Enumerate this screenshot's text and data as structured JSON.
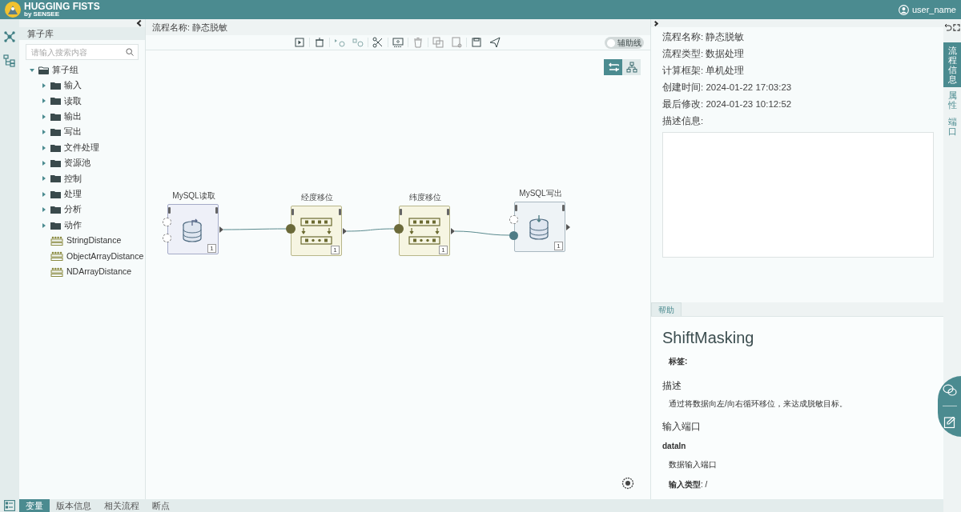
{
  "header": {
    "brand": "HUGGING FISTS",
    "brand_sub": "by SENSEE",
    "user": "user_name"
  },
  "library": {
    "title": "算子库",
    "search_placeholder": "请输入搜索内容",
    "tree": [
      {
        "label": "算子组",
        "kind": "folder",
        "expanded": true,
        "children": [
          {
            "label": "输入",
            "kind": "folder",
            "expanded": false
          },
          {
            "label": "读取",
            "kind": "folder",
            "expanded": false
          },
          {
            "label": "输出",
            "kind": "folder",
            "expanded": false
          },
          {
            "label": "写出",
            "kind": "folder",
            "expanded": false
          },
          {
            "label": "文件处理",
            "kind": "folder",
            "expanded": false
          },
          {
            "label": "资源池",
            "kind": "folder",
            "expanded": false
          },
          {
            "label": "控制",
            "kind": "folder",
            "expanded": false
          },
          {
            "label": "处理",
            "kind": "folder",
            "expanded": false
          },
          {
            "label": "分析",
            "kind": "folder",
            "expanded": false
          },
          {
            "label": "动作",
            "kind": "folder",
            "expanded": false
          },
          {
            "label": "StringDistance",
            "kind": "operator"
          },
          {
            "label": "ObjectArrayDistance",
            "kind": "operator"
          },
          {
            "label": "NDArrayDistance",
            "kind": "operator"
          }
        ]
      }
    ]
  },
  "flow_title": "流程名称: 静态脱敏",
  "toolbar": {
    "guide_toggle": {
      "label": "辅助线",
      "on": false
    },
    "view_buttons": [
      {
        "kind": "flow",
        "selected": true
      },
      {
        "kind": "tree",
        "selected": false
      }
    ]
  },
  "nodes": [
    {
      "label": "MySQL读取",
      "kind": "mysql_read",
      "count": "1"
    },
    {
      "label": "经度移位",
      "kind": "shift",
      "count": "1"
    },
    {
      "label": "纬度移位",
      "kind": "shift",
      "count": "1"
    },
    {
      "label": "MySQL写出",
      "kind": "mysql_write",
      "count": "1"
    }
  ],
  "info": {
    "lines": [
      "流程名称: 静态脱敏",
      "流程类型: 数据处理",
      "计算框架: 单机处理",
      "创建时间: 2024-01-22 17:03:23",
      "最后修改: 2024-01-23 10:12:52"
    ],
    "description_label": "描述信息:"
  },
  "help": {
    "tab": "帮助",
    "title": "ShiftMasking",
    "tag_label": "标签:",
    "description_heading": "描述",
    "description": "通过将数据向左/向右循环移位，来达成脱敏目标。",
    "input_heading": "输入端口",
    "port_name": "dataIn",
    "port_description": "数据输入端口",
    "input_type": "**输入类型**: /"
  },
  "side_tabs": [
    {
      "label": "流程信息",
      "selected": true
    },
    {
      "label": "属性",
      "selected": false
    },
    {
      "label": "端口",
      "selected": false
    }
  ],
  "bottom_tabs": [
    {
      "label": "变量",
      "selected": true
    },
    {
      "label": "版本信息",
      "selected": false
    },
    {
      "label": "相关流程",
      "selected": false
    },
    {
      "label": "断点",
      "selected": false
    }
  ]
}
